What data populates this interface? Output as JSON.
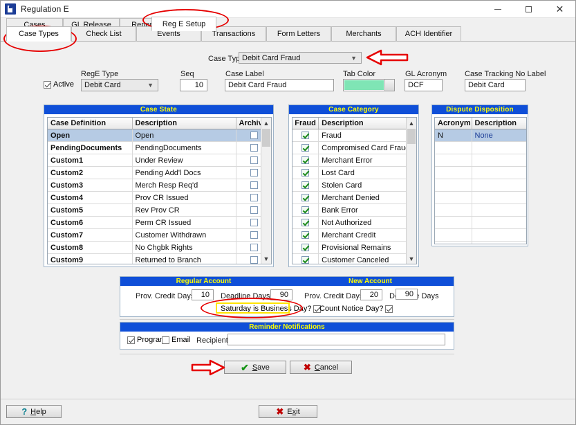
{
  "window": {
    "title": "Regulation E",
    "icon": "app-icon",
    "minimize": "minimize-icon",
    "maximize": "maximize-icon",
    "close": "close-icon"
  },
  "tabs_primary": [
    {
      "label": "Cases",
      "active": false
    },
    {
      "label": "GL Release",
      "active": false
    },
    {
      "label": "Reporting",
      "active": false
    },
    {
      "label": "Reg E Setup",
      "active": true
    }
  ],
  "tabs_secondary": [
    {
      "label": "Case Types",
      "active": true
    },
    {
      "label": "Check List",
      "active": false
    },
    {
      "label": "Events",
      "active": false
    },
    {
      "label": "Transactions",
      "active": false
    },
    {
      "label": "Form Letters",
      "active": false
    },
    {
      "label": "Merchants",
      "active": false
    },
    {
      "label": "ACH Identifier",
      "active": false
    }
  ],
  "form": {
    "case_type_label": "Case Type",
    "case_type_value": "Debit Card Fraud",
    "active_label": "Active",
    "active_checked": true,
    "rege_type_label": "RegE Type",
    "rege_type_value": "Debit Card",
    "seq_label": "Seq",
    "seq_value": "10",
    "case_label_label": "Case Label",
    "case_label_value": "Debit Card Fraud",
    "tab_color_label": "Tab Color",
    "tab_color_value": "#7FE5B5",
    "gl_acronym_label": "GL Acronym",
    "gl_acronym_value": "DCF",
    "case_tracking_label": "Case Tracking No Label",
    "case_tracking_value": "Debit Card"
  },
  "case_state": {
    "title": "Case State",
    "columns": [
      "Case Definition",
      "Description",
      "Archive"
    ],
    "rows": [
      {
        "key": "Open",
        "desc": "Open",
        "archive": false,
        "selected": true
      },
      {
        "key": "PendingDocuments",
        "desc": "PendingDocuments",
        "archive": false,
        "selected": false
      },
      {
        "key": "Custom1",
        "desc": "Under Review",
        "archive": false,
        "selected": false
      },
      {
        "key": "Custom2",
        "desc": "Pending Add'l Docs",
        "archive": false,
        "selected": false
      },
      {
        "key": "Custom3",
        "desc": "Merch Resp Req'd",
        "archive": false,
        "selected": false
      },
      {
        "key": "Custom4",
        "desc": "Prov CR Issued",
        "archive": false,
        "selected": false
      },
      {
        "key": "Custom5",
        "desc": "Rev Prov CR",
        "archive": false,
        "selected": false
      },
      {
        "key": "Custom6",
        "desc": "Perm CR Issued",
        "archive": false,
        "selected": false
      },
      {
        "key": "Custom7",
        "desc": "Customer Withdrawn",
        "archive": false,
        "selected": false
      },
      {
        "key": "Custom8",
        "desc": "No Chgbk Rights",
        "archive": false,
        "selected": false
      },
      {
        "key": "Custom9",
        "desc": "Returned to Branch",
        "archive": false,
        "selected": false
      }
    ]
  },
  "case_category": {
    "title": "Case Category",
    "columns": [
      "Fraud",
      "Description"
    ],
    "rows": [
      {
        "fraud": true,
        "desc": "Fraud"
      },
      {
        "fraud": true,
        "desc": "Compromised Card Fraud"
      },
      {
        "fraud": true,
        "desc": "Merchant Error"
      },
      {
        "fraud": true,
        "desc": "Lost Card"
      },
      {
        "fraud": true,
        "desc": "Stolen Card"
      },
      {
        "fraud": true,
        "desc": "Merchant Denied"
      },
      {
        "fraud": true,
        "desc": "Bank Error"
      },
      {
        "fraud": true,
        "desc": "Not Authorized"
      },
      {
        "fraud": true,
        "desc": "Merchant Credit"
      },
      {
        "fraud": true,
        "desc": "Provisional Remains"
      },
      {
        "fraud": true,
        "desc": "Customer Canceled"
      }
    ]
  },
  "dispute_disposition": {
    "title": "Dispute Disposition",
    "columns": [
      "Acronym",
      "Description"
    ],
    "rows": [
      {
        "acronym": "N",
        "desc": "None",
        "selected": true
      },
      {
        "acronym": "",
        "desc": "",
        "selected": false
      },
      {
        "acronym": "",
        "desc": "",
        "selected": false
      },
      {
        "acronym": "",
        "desc": "",
        "selected": false
      },
      {
        "acronym": "",
        "desc": "",
        "selected": false
      },
      {
        "acronym": "",
        "desc": "",
        "selected": false
      },
      {
        "acronym": "",
        "desc": "",
        "selected": false
      },
      {
        "acronym": "",
        "desc": "",
        "selected": false
      },
      {
        "acronym": "",
        "desc": "",
        "selected": false
      },
      {
        "acronym": "",
        "desc": "",
        "selected": false
      }
    ]
  },
  "accounts": {
    "regular_title": "Regular Account",
    "new_title": "New Account",
    "reg_prov_credit_label": "Prov. Credit Days",
    "reg_prov_credit_value": "10",
    "reg_deadline_label": "Deadline Days",
    "reg_deadline_value": "90",
    "new_prov_credit_label": "Prov. Credit Days",
    "new_prov_credit_value": "20",
    "new_deadline_label": "Deadline Days",
    "new_deadline_value": "90",
    "saturday_label": "Saturday is Business Day?",
    "saturday_checked": true,
    "count_notice_label": "Count Notice Day?",
    "count_notice_checked": true
  },
  "reminder": {
    "title": "Reminder Notifications",
    "program_label": "Program",
    "program_checked": true,
    "email_label": "Email",
    "email_checked": false,
    "recipients_label": "Recipients",
    "recipients_value": ""
  },
  "actions": {
    "save_label": "Save",
    "save_accel": "S",
    "cancel_label": "Cancel",
    "cancel_accel": "C",
    "help_label": "Help",
    "help_accel": "H",
    "exit_label": "Exit",
    "exit_accel": "x"
  },
  "annotations": {
    "color": "#e60000",
    "highlight_color": "#ffe400",
    "items": [
      "oval-around-case-types-tab",
      "oval-around-reg-e-setup-tab",
      "arrow-to-case-type-dropdown",
      "oval-around-saturday-is-business-day",
      "arrow-to-save-button"
    ]
  }
}
